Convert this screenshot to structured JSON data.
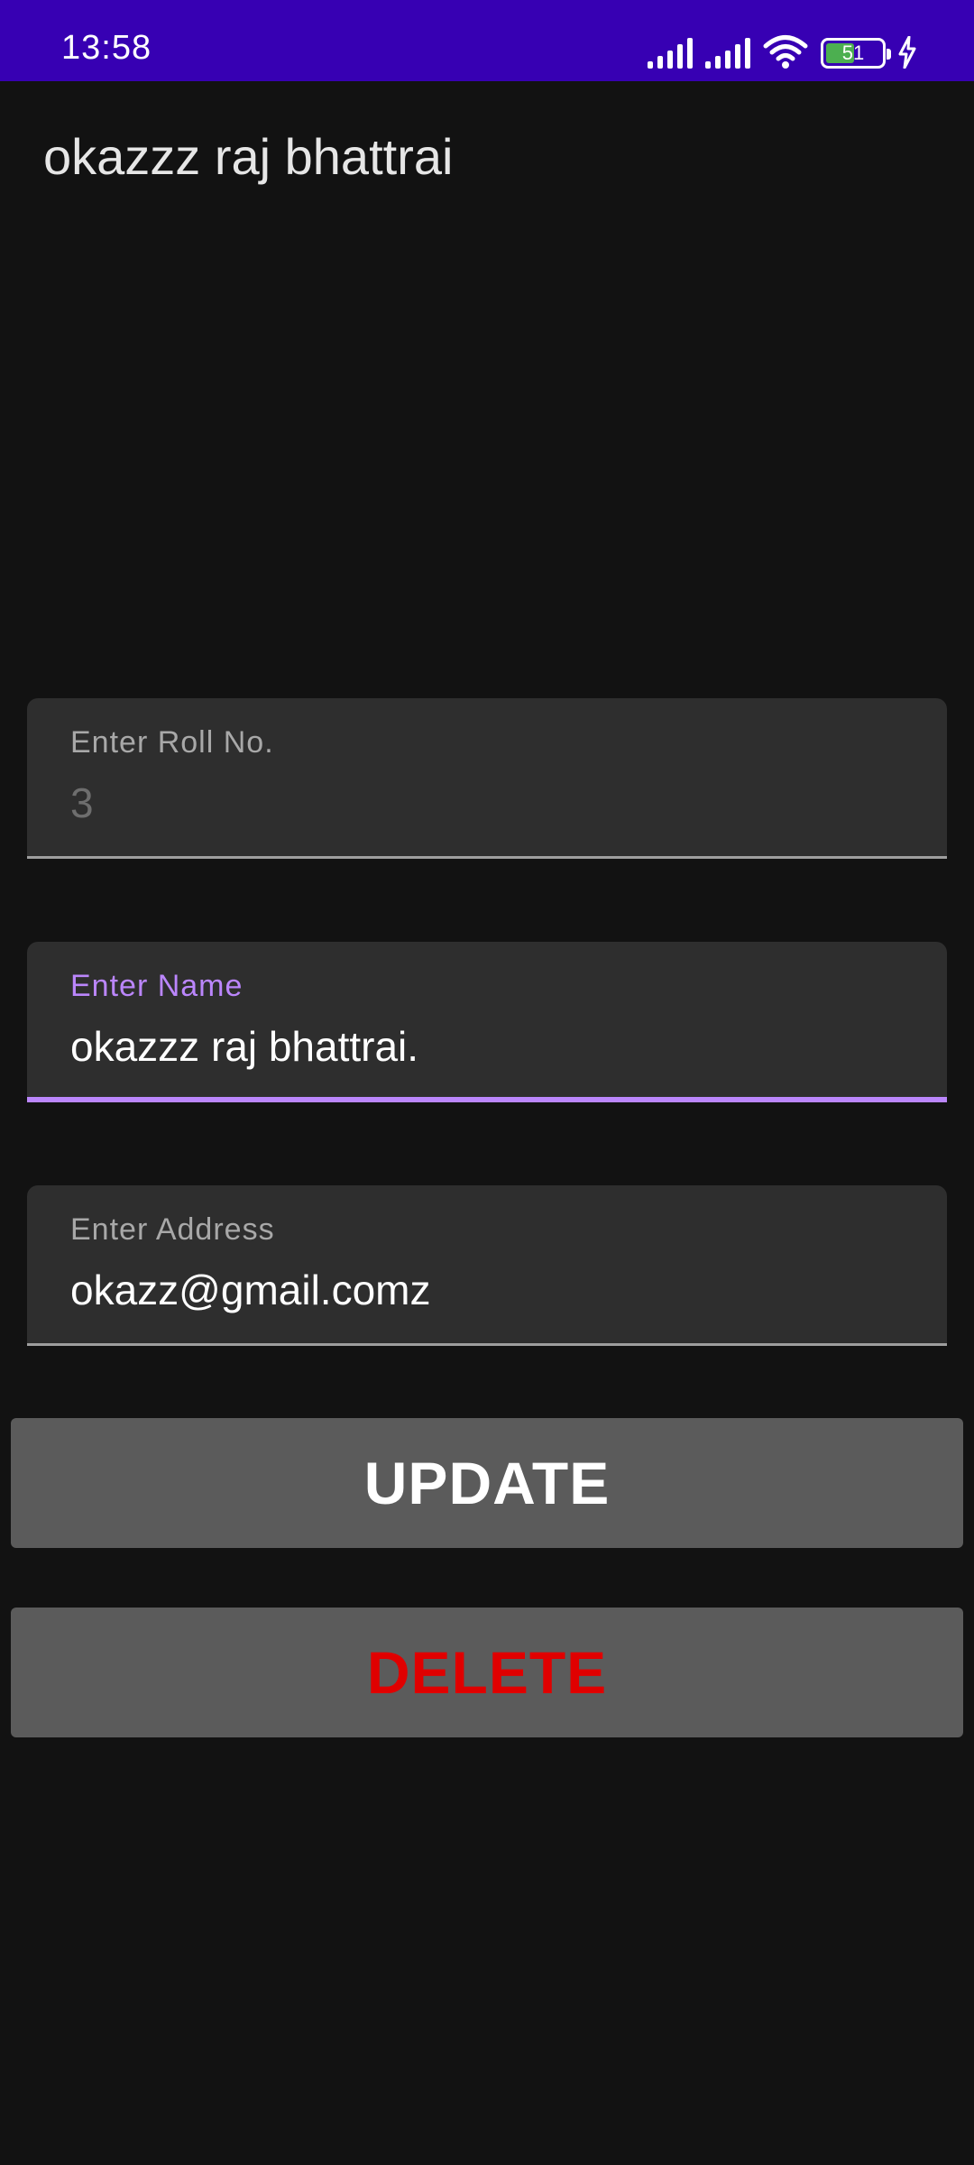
{
  "status_bar": {
    "time": "13:58",
    "battery_level": "51",
    "battery_fraction": 0.51,
    "icons": [
      "signal-icon",
      "signal-icon",
      "wifi-icon",
      "battery-icon",
      "charging-icon"
    ],
    "background": "#3700b3"
  },
  "app": {
    "title": "okazzz raj bhattrai"
  },
  "form": {
    "roll": {
      "label": "Enter Roll No.",
      "value": "3"
    },
    "name": {
      "label": "Enter Name",
      "value": "okazzz raj bhattrai."
    },
    "address": {
      "label": "Enter Address",
      "value": "okazz@gmail.comz"
    }
  },
  "buttons": {
    "update_label": "UPDATE",
    "delete_label": "DELETE"
  },
  "colors": {
    "accent": "#bb86fc",
    "delete_text": "#e00000",
    "update_text": "#ffffff",
    "button_bg": "#5b5b5b"
  }
}
